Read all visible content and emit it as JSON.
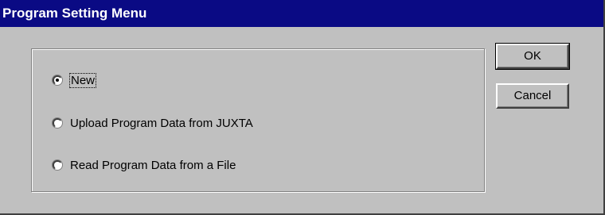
{
  "window": {
    "title": "Program Setting Menu"
  },
  "options": [
    {
      "label": "New",
      "selected": true
    },
    {
      "label": "Upload Program Data from JUXTA",
      "selected": false
    },
    {
      "label": "Read Program Data from a File",
      "selected": false
    }
  ],
  "buttons": {
    "ok_label": "OK",
    "cancel_label": "Cancel"
  },
  "colors": {
    "titlebar": "#0a0a84",
    "face": "#c0c0c0"
  }
}
